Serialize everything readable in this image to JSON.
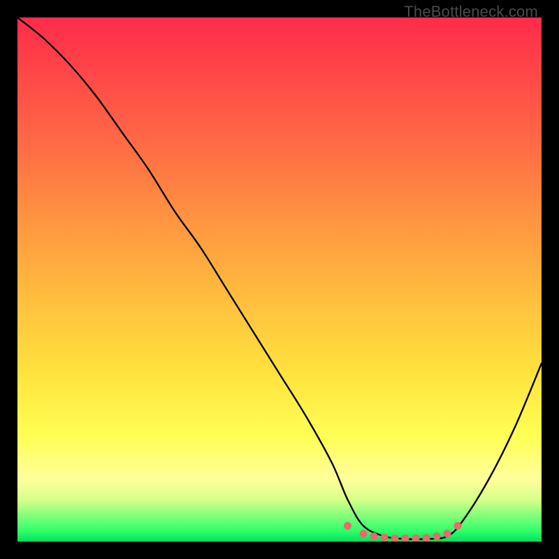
{
  "watermark": "TheBottleneck.com",
  "chart_data": {
    "type": "line",
    "title": "",
    "xlabel": "",
    "ylabel": "",
    "xlim": [
      0,
      100
    ],
    "ylim": [
      0,
      100
    ],
    "series": [
      {
        "name": "bottleneck-curve",
        "x": [
          0,
          5,
          10,
          15,
          20,
          25,
          30,
          35,
          40,
          45,
          50,
          55,
          60,
          63,
          66,
          70,
          74,
          78,
          82,
          85,
          90,
          95,
          100
        ],
        "values": [
          100,
          96,
          91,
          85,
          78,
          71,
          63,
          56,
          48,
          40,
          32,
          24,
          15,
          8,
          3,
          1,
          0.5,
          0.5,
          1,
          4,
          12,
          22,
          34
        ]
      }
    ],
    "markers": {
      "name": "valley-dots",
      "color": "#e86a6a",
      "x": [
        63,
        66,
        68,
        70,
        72,
        74,
        76,
        78,
        80,
        82,
        84
      ],
      "values": [
        3,
        1.5,
        1,
        0.8,
        0.6,
        0.6,
        0.6,
        0.7,
        1,
        1.5,
        3
      ]
    }
  }
}
